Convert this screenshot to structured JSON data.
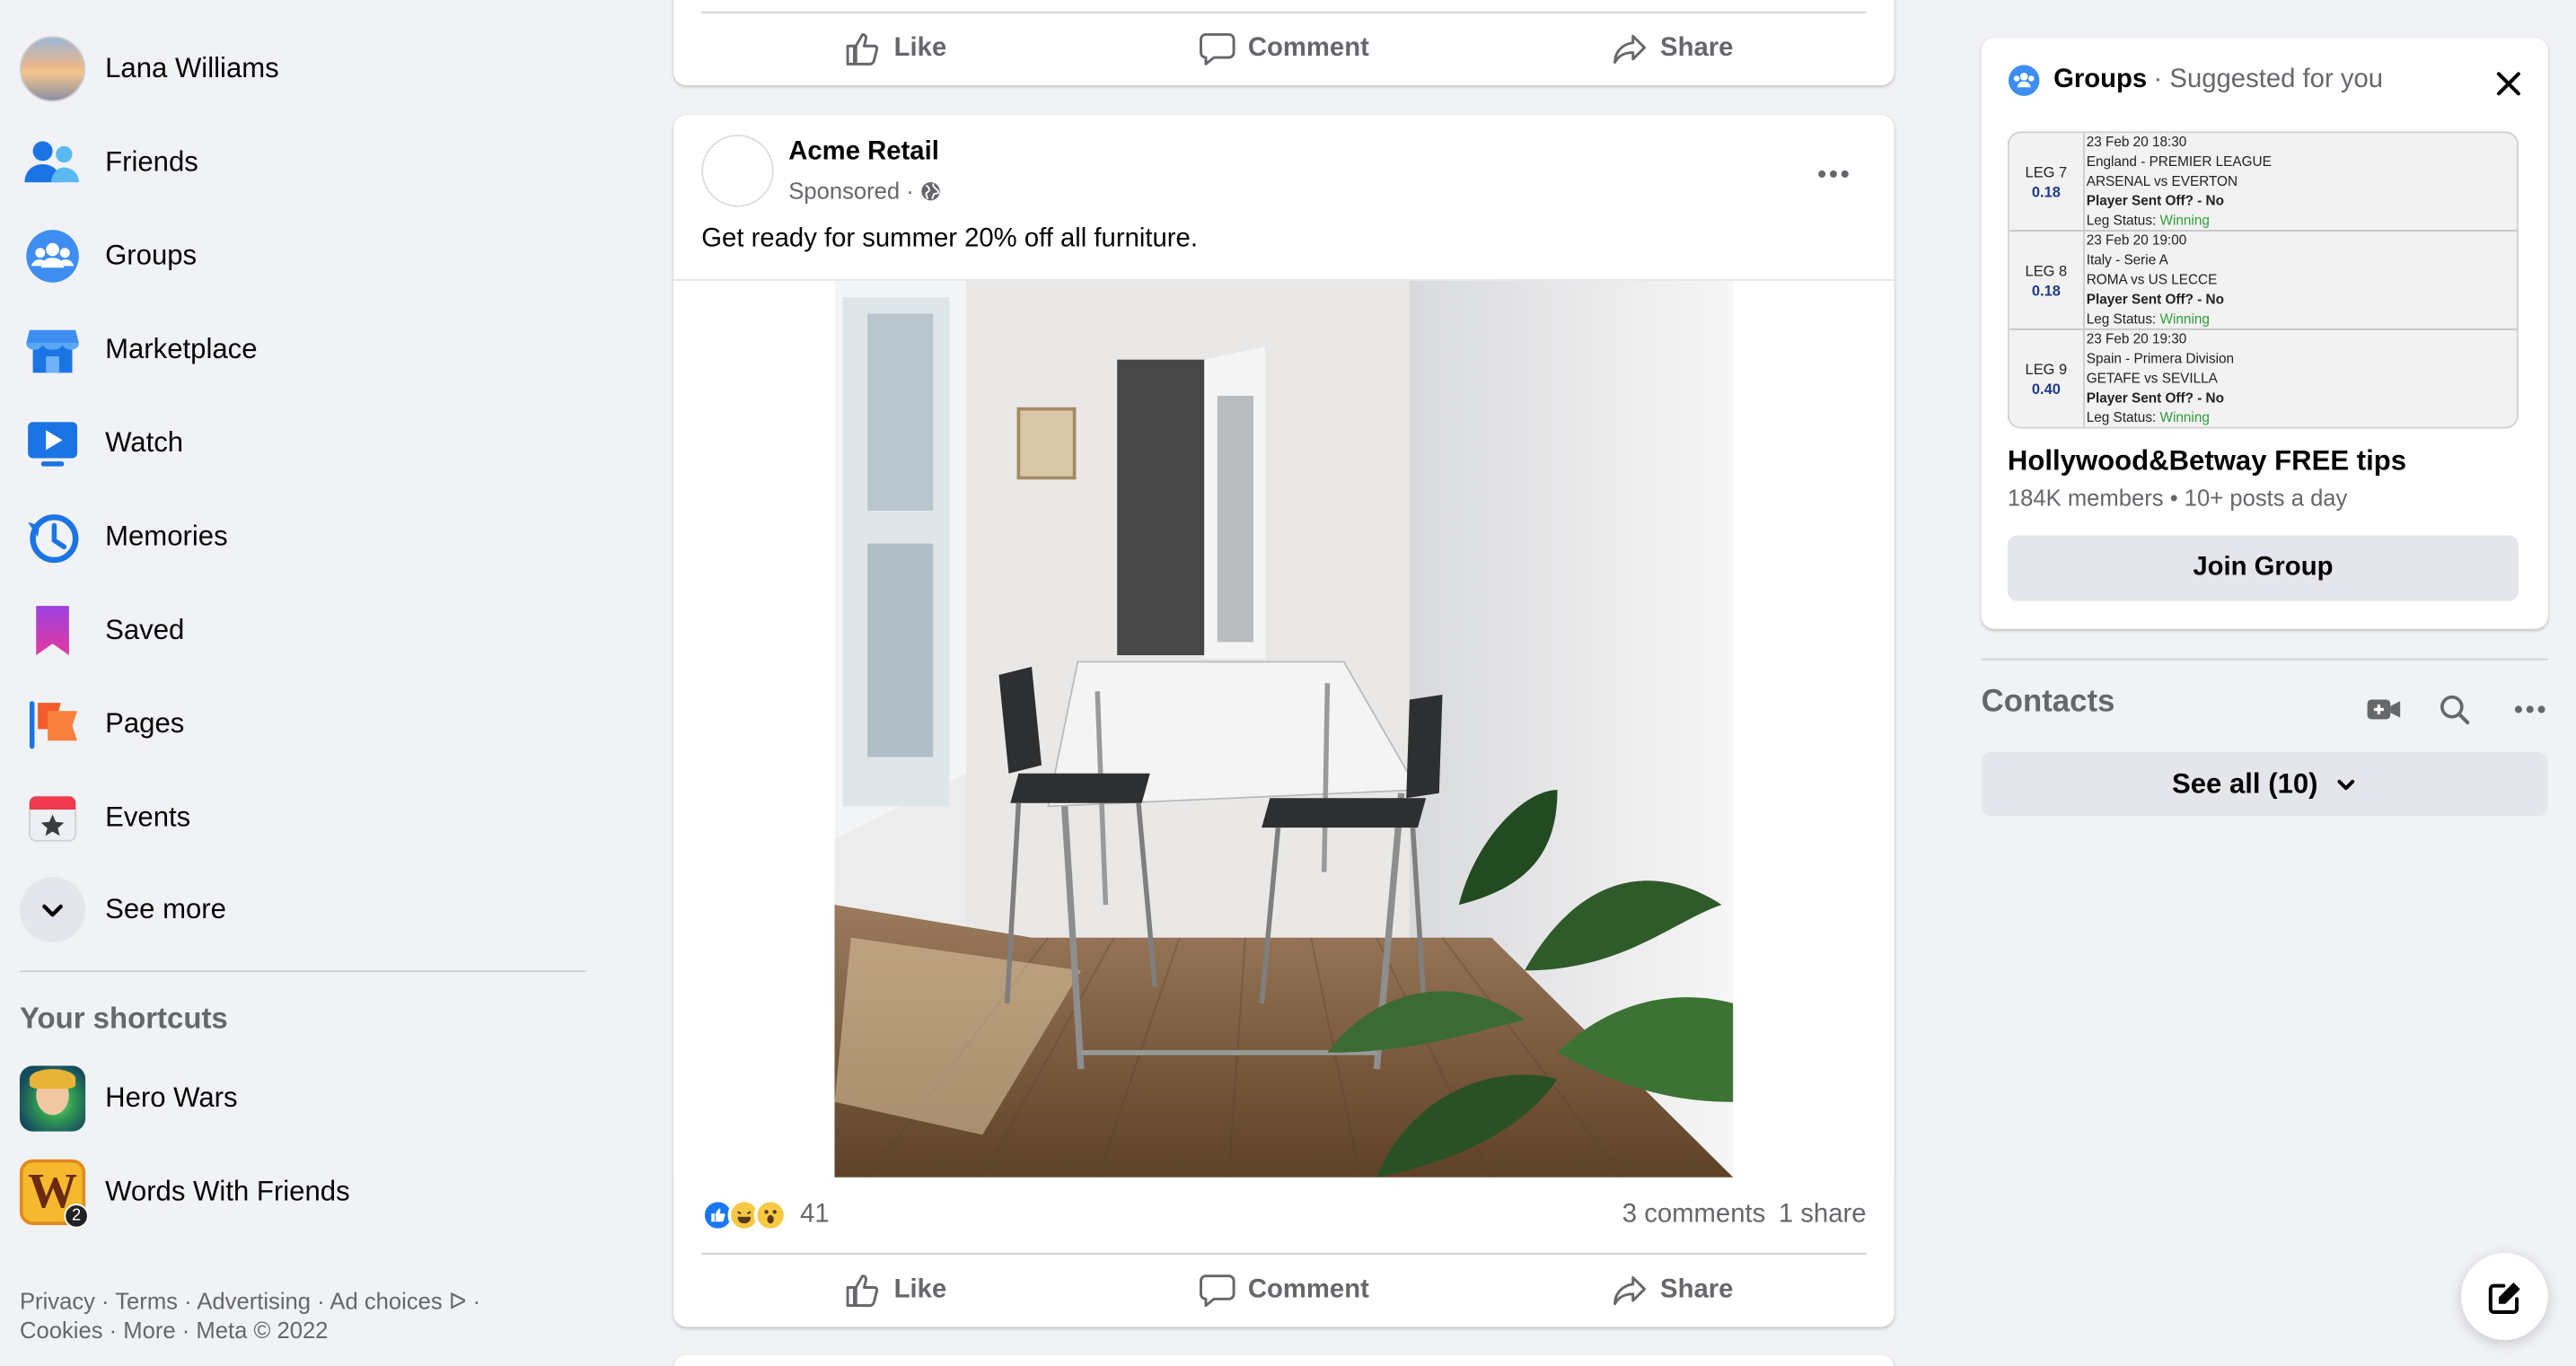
{
  "sidebar": {
    "items": [
      {
        "label": "Lana Williams",
        "icon": "profile-avatar"
      },
      {
        "label": "Friends",
        "icon": "friends-icon"
      },
      {
        "label": "Groups",
        "icon": "groups-icon"
      },
      {
        "label": "Marketplace",
        "icon": "marketplace-icon"
      },
      {
        "label": "Watch",
        "icon": "watch-icon"
      },
      {
        "label": "Memories",
        "icon": "memories-icon"
      },
      {
        "label": "Saved",
        "icon": "saved-icon"
      },
      {
        "label": "Pages",
        "icon": "pages-icon"
      },
      {
        "label": "Events",
        "icon": "events-icon"
      },
      {
        "label": "See more",
        "icon": "chevron-down-icon"
      }
    ],
    "shortcuts_title": "Your shortcuts",
    "shortcuts": [
      {
        "label": "Hero Wars",
        "icon": "hero-wars-icon"
      },
      {
        "label": "Words With Friends",
        "icon": "words-with-friends-icon",
        "letter": "W",
        "badge": "2"
      }
    ],
    "footer": {
      "line1": "Privacy · Terms · Advertising · Ad choices ᐅ ·",
      "line2": "Cookies · More · Meta © 2022"
    }
  },
  "feed": {
    "actions": {
      "like": "Like",
      "comment": "Comment",
      "share": "Share"
    },
    "post": {
      "author": "Acme Retail",
      "sponsored": "Sponsored ·",
      "text": "Get ready for summer 20% off all furniture.",
      "reaction_count": "41",
      "comments": "3 comments",
      "shares": "1 share"
    }
  },
  "suggested_group": {
    "header_title": "Groups",
    "header_sub": "· Suggested for you",
    "thumbnail_legs": [
      {
        "leg": "LEG 7",
        "odds": "0.18",
        "time": "23 Feb 20 18:30",
        "league": "England - PREMIER LEAGUE",
        "match": "ARSENAL vs EVERTON",
        "player": "Player Sent Off? - No",
        "status_label": "Leg Status:",
        "status": "Winning"
      },
      {
        "leg": "LEG 8",
        "odds": "0.18",
        "time": "23 Feb 20 19:00",
        "league": "Italy - Serie A",
        "match": "ROMA vs US LECCE",
        "player": "Player Sent Off? - No",
        "status_label": "Leg Status:",
        "status": "Winning"
      },
      {
        "leg": "LEG 9",
        "odds": "0.40",
        "time": "23 Feb 20 19:30",
        "league": "Spain - Primera Division",
        "match": "GETAFE vs SEVILLA",
        "player": "Player Sent Off? - No",
        "status_label": "Leg Status:",
        "status": "Winning"
      }
    ],
    "name": "Hollywood&Betway FREE tips",
    "meta": "184K members • 10+ posts a day",
    "join_label": "Join Group"
  },
  "contacts": {
    "title": "Contacts",
    "see_all": "See all (10)"
  },
  "colors": {
    "background": "#f0f2f5",
    "accent_blue": "#1877f2",
    "secondary_text": "#65676b",
    "win_green": "#2e9e3a"
  }
}
